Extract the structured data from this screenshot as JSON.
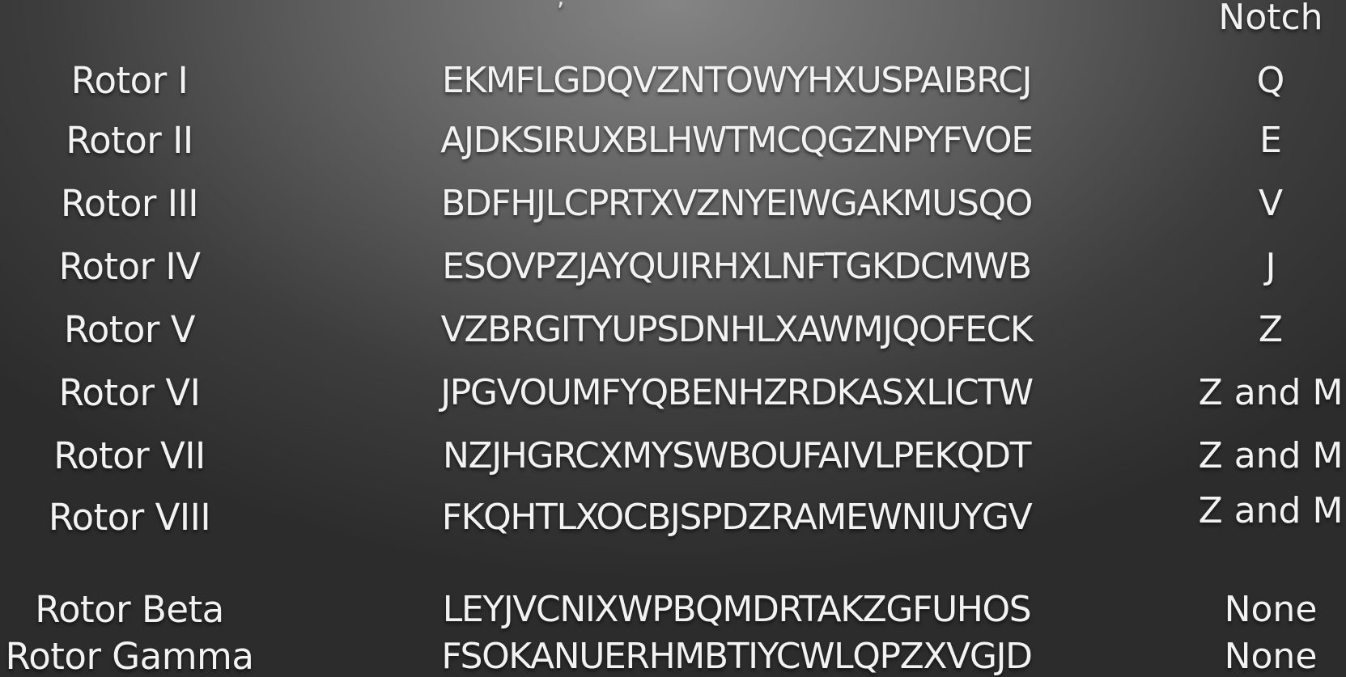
{
  "header": {
    "notch_label": "Notch"
  },
  "rotors": [
    {
      "name": "Rotor I",
      "wiring": "EKMFLGDQVZNTOWYHXUSPAIBRCJ",
      "notch": "Q"
    },
    {
      "name": "Rotor II",
      "wiring": "AJDKSIRUXBLHWTMCQGZNPYFVOE",
      "notch": "E"
    },
    {
      "name": "Rotor III",
      "wiring": "BDFHJLCPRTXVZNYEIWGAKMUSQO",
      "notch": "V"
    },
    {
      "name": "Rotor IV",
      "wiring": "ESOVPZJAYQUIRHXLNFTGKDCMWB",
      "notch": "J"
    },
    {
      "name": "Rotor V",
      "wiring": "VZBRGITYUPSDNHLXAWMJQOFECK",
      "notch": "Z"
    },
    {
      "name": "Rotor VI",
      "wiring": "JPGVOUMFYQBENHZRDKASXLICTW",
      "notch": "Z and M"
    },
    {
      "name": "Rotor VII",
      "wiring": "NZJHGRCXMYSWBOUFAIVLPEKQDT",
      "notch": "Z and M"
    },
    {
      "name": "Rotor VIII",
      "wiring": "FKQHTLXOCBJSPDZRAMEWNIUYGV",
      "notch": "Z and M"
    },
    {
      "name": "Rotor Beta",
      "wiring": "LEYJVCNIXWPBQMDRTAKZGFUHOS",
      "notch": "None"
    },
    {
      "name": "Rotor Gamma",
      "wiring": "FSOKANUERHMBTIYCWLQPZXVGJD",
      "notch": "None"
    }
  ]
}
